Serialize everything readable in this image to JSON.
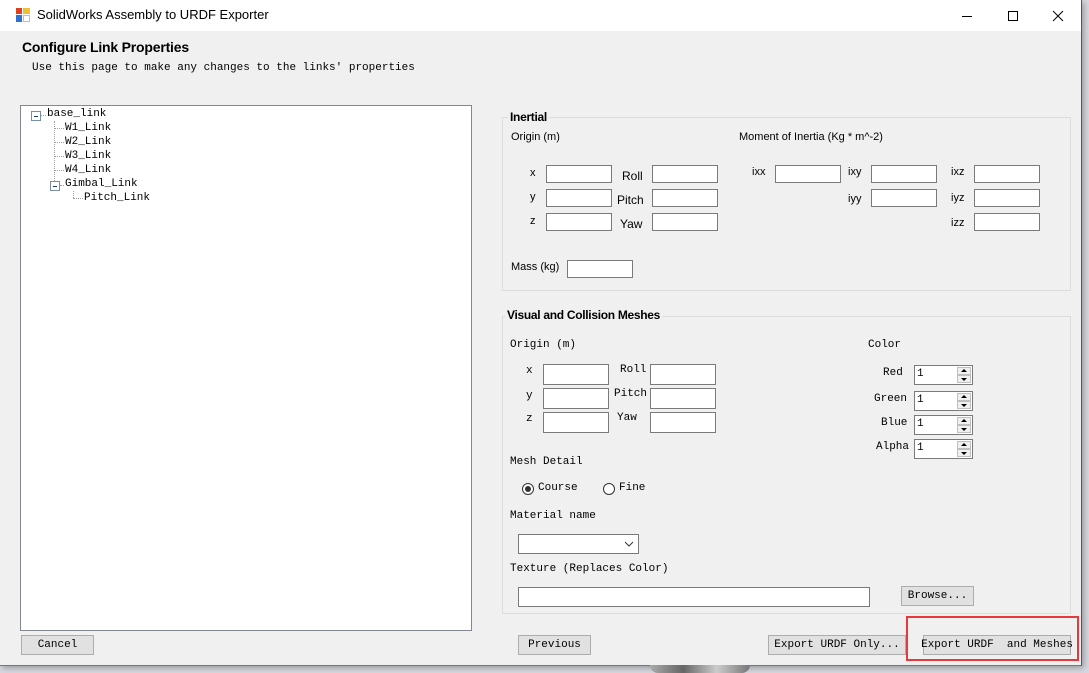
{
  "window": {
    "title": "SolidWorks Assembly to URDF Exporter",
    "controls": {
      "minimize": "minimize-icon",
      "maximize": "maximize-icon",
      "close": "close-icon"
    }
  },
  "header": {
    "title": "Configure Link Properties",
    "subtitle": "Use this page to make any changes to the links' properties"
  },
  "tree": {
    "nodes": [
      {
        "label": "base_link",
        "level": 0,
        "expanded": true
      },
      {
        "label": "W1_Link",
        "level": 1
      },
      {
        "label": "W2_Link",
        "level": 1
      },
      {
        "label": "W3_Link",
        "level": 1
      },
      {
        "label": "W4_Link",
        "level": 1
      },
      {
        "label": "Gimbal_Link",
        "level": 1,
        "expanded": true
      },
      {
        "label": "Pitch_Link",
        "level": 2
      }
    ]
  },
  "inertial": {
    "title": "Inertial",
    "origin_label": "Origin (m)",
    "moment_label": "Moment of Inertia (Kg * m^-2)",
    "x_label": "x",
    "y_label": "y",
    "z_label": "z",
    "roll_label": "Roll",
    "pitch_label": "Pitch",
    "yaw_label": "Yaw",
    "ixx_label": "ixx",
    "ixy_label": "ixy",
    "ixz_label": "ixz",
    "iyy_label": "iyy",
    "iyz_label": "iyz",
    "izz_label": "izz",
    "mass_label": "Mass (kg)",
    "values": {
      "x": "",
      "y": "",
      "z": "",
      "roll": "",
      "pitch": "",
      "yaw": "",
      "ixx": "",
      "ixy": "",
      "ixz": "",
      "iyy": "",
      "iyz": "",
      "izz": "",
      "mass": ""
    }
  },
  "visual": {
    "title": "Visual and Collision Meshes",
    "origin_label": "Origin (m)",
    "x_label": "x",
    "y_label": "y",
    "z_label": "z",
    "roll_label": "Roll",
    "pitch_label": "Pitch",
    "yaw_label": "Yaw",
    "values": {
      "x": "",
      "y": "",
      "z": "",
      "roll": "",
      "pitch": "",
      "yaw": ""
    },
    "color_label": "Color",
    "red_label": "Red",
    "green_label": "Green",
    "blue_label": "Blue",
    "alpha_label": "Alpha",
    "red": "1",
    "green": "1",
    "blue": "1",
    "alpha": "1",
    "mesh_detail_label": "Mesh Detail",
    "course_label": "Course",
    "fine_label": "Fine",
    "mesh_detail_selected": "Course",
    "material_label": "Material name",
    "material_value": "",
    "texture_label": "Texture (Replaces Color)",
    "texture_value": "",
    "browse_label": "Browse..."
  },
  "footer": {
    "cancel_label": "Cancel",
    "previous_label": "Previous",
    "export_urdf_only_label": "Export URDF Only...",
    "export_urdf_meshes_label": "Export URDF  and Meshes"
  },
  "colors": {
    "highlight": "#e8383b",
    "window_bg": "#f0f0f0",
    "button_bg": "#e1e1e1"
  }
}
